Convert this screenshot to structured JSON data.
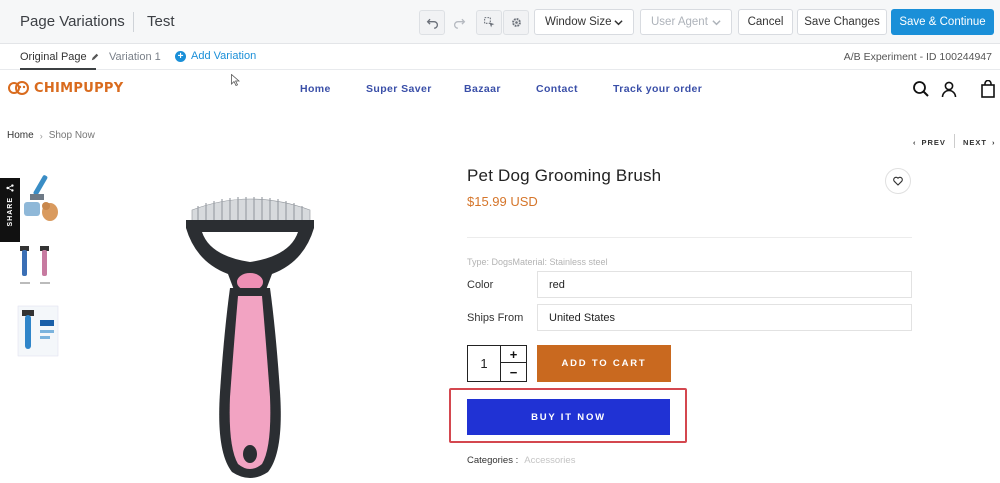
{
  "editor": {
    "title": "Page Variations",
    "test_name": "Test",
    "window_size_label": "Window Size",
    "user_agent_placeholder": "User Agent",
    "cancel_label": "Cancel",
    "save_changes_label": "Save Changes",
    "save_continue_label": "Save & Continue",
    "tabs": [
      {
        "label": "Original Page",
        "active": true
      },
      {
        "label": "Variation 1",
        "active": false
      }
    ],
    "add_variation_label": "Add Variation",
    "experiment_id": "A/B Experiment - ID 100244947",
    "icons": [
      "undo-icon",
      "redo-icon",
      "element-select-icon",
      "gear-icon"
    ]
  },
  "store": {
    "logo_text": "CHIMPUPPY",
    "nav": [
      "Home",
      "Super Saver",
      "Bazaar",
      "Contact",
      "Track your order"
    ],
    "header_icons": [
      "search-icon",
      "user-icon",
      "cart-bag-icon"
    ],
    "breadcrumb": {
      "home": "Home",
      "current": "Shop Now"
    },
    "prev_label": "PREV",
    "next_label": "NEXT",
    "share_label": "SHARE"
  },
  "product": {
    "title": "Pet Dog Grooming Brush",
    "price": "$15.99 USD",
    "type_line": "Type: DogsMaterial: Stainless steel",
    "color_label": "Color",
    "color_value": "red",
    "ships_label": "Ships From",
    "ships_value": "United States",
    "quantity": "1",
    "plus": "+",
    "minus": "−",
    "add_to_cart": "ADD TO CART",
    "buy_now": "BUY IT NOW",
    "categories_label": "Categories :",
    "categories_value": "Accessories"
  },
  "colors": {
    "accent_blue": "#1a8fd8",
    "nav_blue": "#3a4fa8",
    "price_orange": "#d5752a",
    "add_to_cart": "#c9691f",
    "buy_now": "#2032d4",
    "highlight": "#d4474f"
  }
}
